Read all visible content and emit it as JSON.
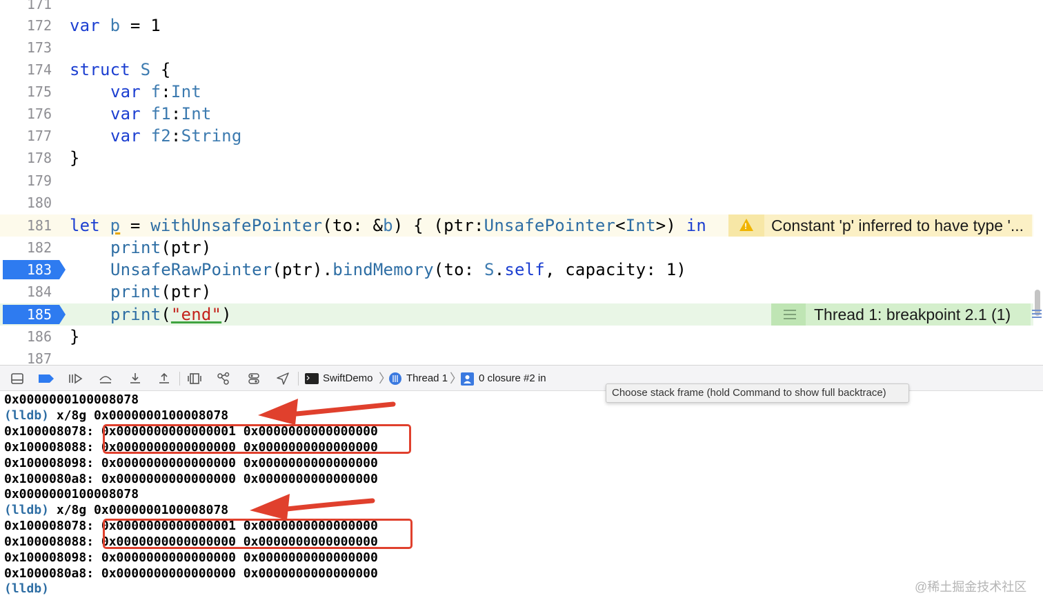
{
  "editor": {
    "lines": [
      {
        "num": "171"
      },
      {
        "num": "172"
      },
      {
        "num": "173"
      },
      {
        "num": "174"
      },
      {
        "num": "175"
      },
      {
        "num": "176"
      },
      {
        "num": "177"
      },
      {
        "num": "178"
      },
      {
        "num": "179"
      },
      {
        "num": "180"
      },
      {
        "num": "181"
      },
      {
        "num": "182"
      },
      {
        "num": "183"
      },
      {
        "num": "184"
      },
      {
        "num": "185"
      },
      {
        "num": "186"
      },
      {
        "num": "187"
      }
    ],
    "code": {
      "l172": {
        "kw": "var",
        "name": "b",
        "rest": " = 1"
      },
      "l174": {
        "kw": "struct",
        "name": "S",
        "rest": " {"
      },
      "l175": {
        "kw": "var",
        "name": "f",
        "colon": ":",
        "type": "Int"
      },
      "l176": {
        "kw": "var",
        "name": "f1",
        "colon": ":",
        "type": "Int"
      },
      "l177": {
        "kw": "var",
        "name": "f2",
        "colon": ":",
        "type": "String"
      },
      "l178": {
        "text": "}"
      },
      "l181": {
        "kw": "let",
        "name": "p",
        "eq": " = ",
        "fn": "withUnsafePointer",
        "a": "(to: &",
        "b": "b",
        "c": ") { (ptr:",
        "type1": "UnsafePointer",
        "lt": "<",
        "type2": "Int",
        "gt": ">) ",
        "in": "in"
      },
      "l182": {
        "fn": "print",
        "rest": "(ptr)"
      },
      "l183": {
        "type": "UnsafeRawPointer",
        "a": "(ptr).",
        "fn": "bindMemory",
        "b": "(to: ",
        "s": "S",
        "dot": ".",
        "self": "self",
        "c": ", capacity: 1)"
      },
      "l184": {
        "fn": "print",
        "rest": "(ptr)"
      },
      "l185": {
        "fn": "print",
        "open": "(",
        "str": "\"end\"",
        "close": ")"
      },
      "l186": {
        "text": "}"
      }
    },
    "warning": {
      "text": "Constant 'p' inferred to have type '...",
      "icon": "warning-triangle-icon",
      "color": "#f0b400"
    },
    "breakpoint_badge": {
      "text": "Thread 1: breakpoint 2.1 (1)"
    },
    "breakpoint_color": "#2e7bf0"
  },
  "debugbar": {
    "breadcrumbs": [
      {
        "label": "SwiftDemo",
        "icon": "terminal-icon"
      },
      {
        "label": "Thread 1",
        "icon": "thread-icon"
      },
      {
        "label": "0 closure #2 in",
        "icon": "user-frame-icon"
      }
    ],
    "tooltip": "Choose stack frame (hold Command to show full backtrace)"
  },
  "console": {
    "lines": [
      {
        "text": "0x0000000100008078"
      },
      {
        "prompt": "(lldb)",
        "cmd": " x/8g 0x0000000100008078"
      },
      {
        "text": "0x100008078: 0x0000000000000001 0x0000000000000000"
      },
      {
        "text": "0x100008088: 0x0000000000000000 0x0000000000000000"
      },
      {
        "text": "0x100008098: 0x0000000000000000 0x0000000000000000"
      },
      {
        "text": "0x1000080a8: 0x0000000000000000 0x0000000000000000"
      },
      {
        "text": "0x0000000100008078"
      },
      {
        "prompt": "(lldb)",
        "cmd": " x/8g 0x0000000100008078"
      },
      {
        "text": "0x100008078: 0x0000000000000001 0x0000000000000000"
      },
      {
        "text": "0x100008088: 0x0000000000000000 0x0000000000000000"
      },
      {
        "text": "0x100008098: 0x0000000000000000 0x0000000000000000"
      },
      {
        "text": "0x1000080a8: 0x0000000000000000 0x0000000000000000"
      },
      {
        "prompt": "(lldb)"
      }
    ]
  },
  "annotation_color": "#e0402d",
  "watermark": "@稀土掘金技术社区"
}
